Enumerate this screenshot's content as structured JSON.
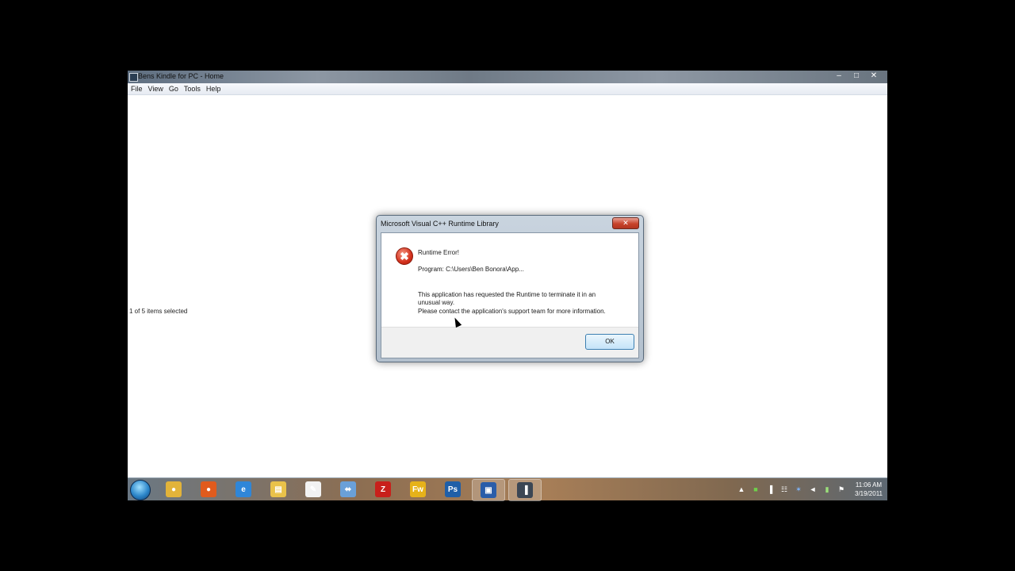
{
  "window": {
    "title": "Bens Kindle for PC - Home",
    "controls": {
      "minimize": "–",
      "maximize": "□",
      "close": "✕"
    },
    "menu": [
      "File",
      "View",
      "Go",
      "Tools",
      "Help"
    ],
    "status": "1 of 5 items selected"
  },
  "dialog": {
    "title": "Microsoft Visual C++ Runtime Library",
    "close_glyph": "✕",
    "icon": "error-icon",
    "heading": "Runtime Error!",
    "program": "Program: C:\\Users\\Ben Bonora\\App...",
    "message_line1": "This application has requested the Runtime to terminate it in an unusual way.",
    "message_line2": "Please contact the application's support team for more information.",
    "ok_label": "OK"
  },
  "taskbar": {
    "apps": [
      {
        "name": "chrome-icon",
        "glyph": "●",
        "color": "#e2b33a"
      },
      {
        "name": "firefox-icon",
        "glyph": "●",
        "color": "#e05b1d"
      },
      {
        "name": "ie-icon",
        "glyph": "e",
        "color": "#2f86d8"
      },
      {
        "name": "explorer-icon",
        "glyph": "▤",
        "color": "#e9c24a"
      },
      {
        "name": "notepad-icon",
        "glyph": "✎",
        "color": "#f2f2f2"
      },
      {
        "name": "network-icon",
        "glyph": "⬌",
        "color": "#6aa0d8"
      },
      {
        "name": "filezilla-icon",
        "glyph": "Z",
        "color": "#c8201b"
      },
      {
        "name": "fireworks-icon",
        "glyph": "Fw",
        "color": "#e6b21a"
      },
      {
        "name": "photoshop-icon",
        "glyph": "Ps",
        "color": "#1f5fa8"
      },
      {
        "name": "app-window-icon",
        "glyph": "▣",
        "color": "#2a5da9"
      },
      {
        "name": "kindle-icon",
        "glyph": "▐",
        "color": "#3b4654"
      }
    ],
    "clock_time": "11:06 AM",
    "clock_date": "3/19/2011"
  }
}
